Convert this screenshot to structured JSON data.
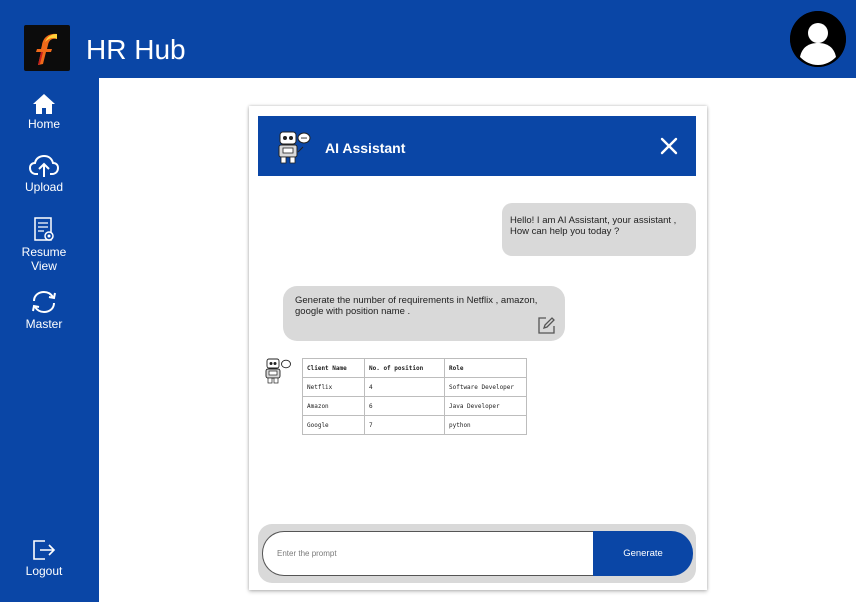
{
  "app": {
    "title": "HR Hub"
  },
  "sidebar": {
    "items": [
      {
        "label": "Home",
        "icon": "home-icon"
      },
      {
        "label": "Upload",
        "icon": "upload-icon"
      },
      {
        "label_line1": "Resume",
        "label_line2": "View",
        "icon": "resume-view-icon"
      },
      {
        "label": "Master",
        "icon": "sync-icon"
      }
    ],
    "logout": {
      "label": "Logout",
      "icon": "logout-icon"
    }
  },
  "assistant": {
    "title": "AI Assistant",
    "greeting_line1": "Hello! I am AI Assistant, your assistant ,",
    "greeting_line2": "How can help you today ?",
    "user_message_line1": "Generate the number of requirements in Netflix , amazon,",
    "user_message_line2": "google with position name ."
  },
  "result_table": {
    "headers": [
      "Client Name",
      "No. of position",
      "Role"
    ],
    "rows": [
      [
        "Netflix",
        "4",
        "Software Developer"
      ],
      [
        "Amazon",
        "6",
        "Java Developer"
      ],
      [
        "Google",
        "7",
        "python"
      ]
    ]
  },
  "prompt": {
    "placeholder": "Enter the prompt",
    "value": ""
  },
  "generate_label": "Generate",
  "colors": {
    "brand_blue": "#0a46a6",
    "bubble_gray": "#d9d9d9"
  }
}
